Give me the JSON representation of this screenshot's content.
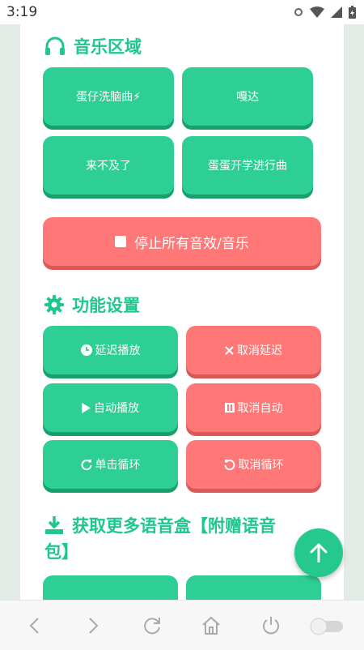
{
  "status": {
    "time": "3:19"
  },
  "music": {
    "title": "音乐区域",
    "buttons": [
      {
        "label": "蛋仔洗脑曲⚡"
      },
      {
        "label": "嘎达"
      },
      {
        "label": "来不及了"
      },
      {
        "label": "蛋蛋开学进行曲"
      }
    ],
    "stop_label": "停止所有音效/音乐"
  },
  "settings": {
    "title": "功能设置",
    "buttons": [
      {
        "label": "延迟播放",
        "icon": "clock-icon"
      },
      {
        "label": "取消延迟",
        "icon": "x-icon"
      },
      {
        "label": "自动播放",
        "icon": "play-icon"
      },
      {
        "label": "取消自动",
        "icon": "pause-icon"
      },
      {
        "label": "单击循环",
        "icon": "redo-icon"
      },
      {
        "label": "取消循环",
        "icon": "undo-icon"
      }
    ]
  },
  "more": {
    "title_line1": "获取更多语音盒【附赠语音",
    "title_line2": "包】"
  },
  "colors": {
    "accent": "#1fc78c",
    "green_button": "#2dcf94",
    "red_button": "#ff7777"
  }
}
